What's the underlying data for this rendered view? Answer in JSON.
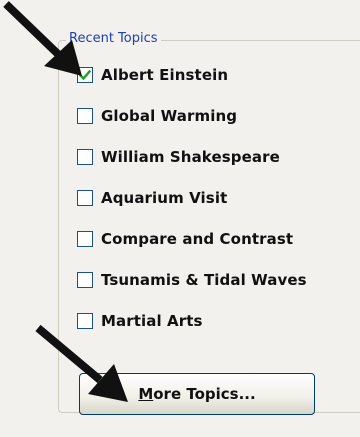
{
  "group": {
    "title": "Recent Topics"
  },
  "topics": [
    {
      "label": "Albert Einstein",
      "checked": true
    },
    {
      "label": "Global Warming",
      "checked": false
    },
    {
      "label": "William Shakespeare",
      "checked": false
    },
    {
      "label": "Aquarium Visit",
      "checked": false
    },
    {
      "label": "Compare and Contrast",
      "checked": false
    },
    {
      "label": "Tsunamis & Tidal Waves",
      "checked": false
    },
    {
      "label": "Martial Arts",
      "checked": false
    }
  ],
  "more_button": {
    "mnemonic": "M",
    "rest": "ore Topics..."
  },
  "colors": {
    "panel": "#f2f1ed",
    "legend_text": "#1f3fb0",
    "checkbox_border": "#1c5180",
    "check_mark": "#21a121",
    "arrow": "#111111"
  },
  "icons": {
    "check": "check-mark-icon",
    "pointer_arrow": "arrow-pointer-icon"
  }
}
